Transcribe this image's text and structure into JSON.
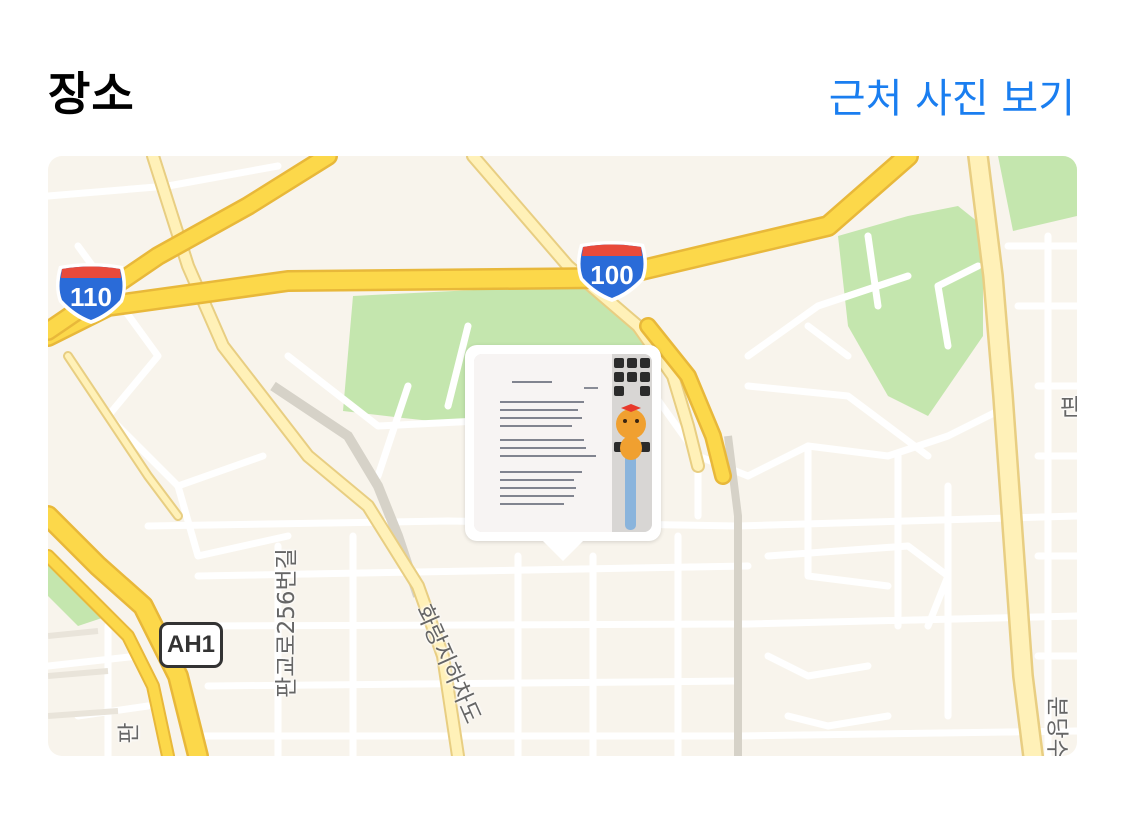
{
  "header": {
    "title": "장소",
    "nearby_link": "근처 사진 보기"
  },
  "map": {
    "highway_shields": [
      {
        "number": "110"
      },
      {
        "number": "100"
      }
    ],
    "route_badge": "AH1",
    "road_labels": [
      {
        "text": "판교로256번길"
      },
      {
        "text": "화랑지하차도"
      },
      {
        "text": "분당수"
      },
      {
        "text": "판"
      },
      {
        "text": "판"
      }
    ],
    "photo_pin": {
      "icon": "photo-thumbnail"
    }
  },
  "colors": {
    "accent": "#1a7ef0",
    "map_background": "#f8f4ec",
    "park": "#c4e6ae",
    "major_road": "#fcd84a",
    "shield_blue": "#2a6bd8",
    "shield_red": "#e84a3b"
  }
}
